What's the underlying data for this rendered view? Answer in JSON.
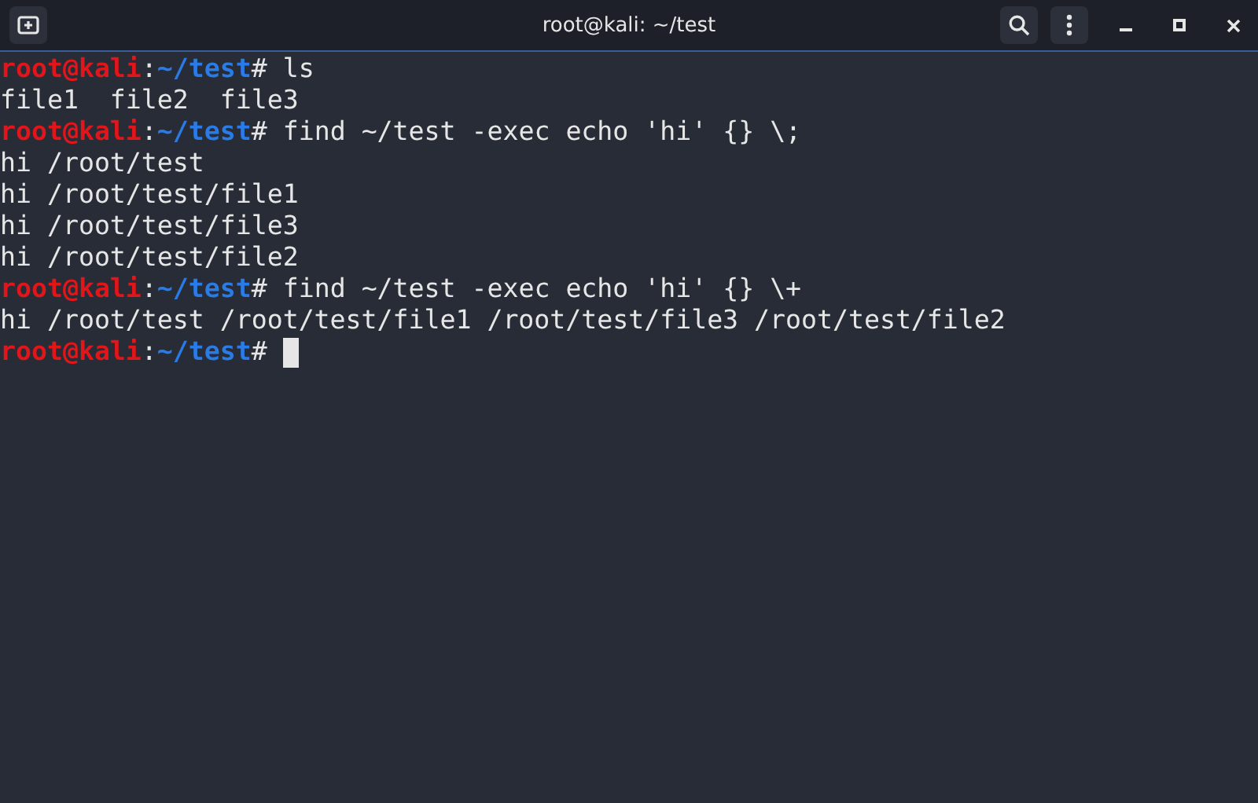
{
  "window": {
    "title": "root@kali: ~/test"
  },
  "terminal": {
    "lines": [
      {
        "kind": "prompt",
        "user": "root@kali",
        "sep": ":",
        "path": "~/test",
        "symbol": "#",
        "command": " ls",
        "cursor": false
      },
      {
        "kind": "output",
        "text": "file1  file2  file3"
      },
      {
        "kind": "prompt",
        "user": "root@kali",
        "sep": ":",
        "path": "~/test",
        "symbol": "#",
        "command": " find ~/test -exec echo 'hi' {} \\;",
        "cursor": false
      },
      {
        "kind": "output",
        "text": "hi /root/test"
      },
      {
        "kind": "output",
        "text": "hi /root/test/file1"
      },
      {
        "kind": "output",
        "text": "hi /root/test/file3"
      },
      {
        "kind": "output",
        "text": "hi /root/test/file2"
      },
      {
        "kind": "prompt",
        "user": "root@kali",
        "sep": ":",
        "path": "~/test",
        "symbol": "#",
        "command": " find ~/test -exec echo 'hi' {} \\+",
        "cursor": false
      },
      {
        "kind": "output",
        "text": "hi /root/test /root/test/file1 /root/test/file3 /root/test/file2"
      },
      {
        "kind": "prompt",
        "user": "root@kali",
        "sep": ":",
        "path": "~/test",
        "symbol": "#",
        "cursor": true
      }
    ]
  }
}
